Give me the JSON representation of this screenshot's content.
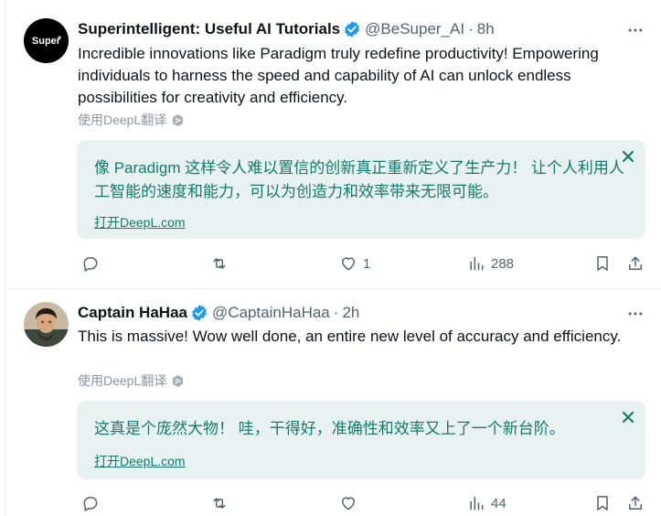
{
  "tweets": [
    {
      "avatar_text": "Super",
      "name": "Superintelligent: Useful AI Tutorials",
      "handle": "@BeSuper_AI",
      "separator": "·",
      "time": "8h",
      "text": "Incredible innovations like Paradigm truly redefine productivity! Empowering individuals to harness the speed and capability of AI can unlock endless possibilities for creativity and efficiency.",
      "deepl_label": "使用DeepL翻译",
      "translation": "像 Paradigm 这样令人难以置信的创新真正重新定义了生产力！ 让个人利用人工智能的速度和能力，可以为创造力和效率带来无限可能。",
      "open_deepl": "打开DeepL.com",
      "likes": "1",
      "views": "288"
    },
    {
      "name": "Captain HaHaa",
      "handle": "@CaptainHaHaa",
      "separator": "·",
      "time": "2h",
      "text": "This is massive! Wow well done, an entire new level of accuracy and efficiency.",
      "deepl_label": "使用DeepL翻译",
      "translation": "这真是个庞然大物！ 哇，干得好，准确性和效率又上了一个新台阶。",
      "open_deepl": "打开DeepL.com",
      "likes": "",
      "views": "44"
    }
  ],
  "colors": {
    "verified": "#1d9bf0",
    "card_bg": "#e8f3f1",
    "card_text": "#147a6e",
    "muted": "#536471"
  },
  "icons": [
    "verified-badge-icon",
    "more-icon",
    "deepl-icon",
    "close-icon",
    "reply-icon",
    "repost-icon",
    "like-icon",
    "views-icon",
    "bookmark-icon",
    "share-icon"
  ]
}
